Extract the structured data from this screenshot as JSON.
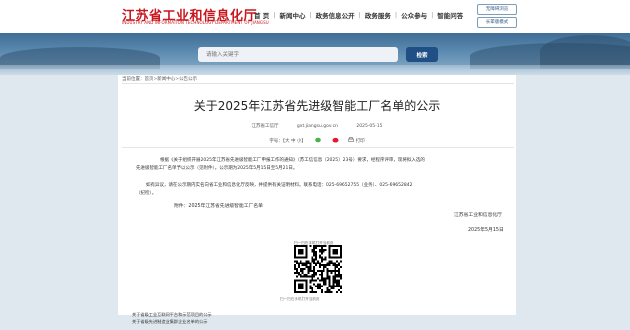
{
  "header": {
    "site_title": "江苏省工业和信息化厅",
    "site_subtitle": "INDUSTRY AND INFORMATION TECHNOLOGY DEPARTMENT OF JIANGSU",
    "nav": [
      "首 页",
      "新闻中心",
      "政务信息公开",
      "政务服务",
      "公众参与",
      "智能问答"
    ],
    "side_buttons": [
      "无障碍浏览",
      "长辈版模式"
    ]
  },
  "search": {
    "placeholder": "请输入关键字",
    "button_label": "检索"
  },
  "breadcrumb": {
    "label": "当前位置：",
    "items": [
      "首页",
      "新闻中心",
      "公告公示"
    ]
  },
  "article": {
    "title": "关于2025年江苏省先进级智能工厂名单的公示",
    "source": "江苏省工信厅",
    "url": "gxt.jiangsu.gov.cn",
    "date": "2025-05-15",
    "font_size_label": "字号：【大 中 小】",
    "print_label": "打印",
    "paragraph1": [
      "根据《关于组织开展2025年江苏省先进级智能工厂申报工作的通知》（苏工信信息〔2025〕23号）要求，经程序评审，现将拟入选的",
      "先进级智能工厂名单予以公示（见附件）。公示期为2025年5月15日至5月21日。"
    ],
    "paragraph2": [
      "如有异议，请在公示期内实名向省工业和信息化厅反映，并提供有关证明材料。联系电话：025-69652755（业务）、025-69652842",
      "（纪检）。"
    ],
    "attachment": "附件：2025年江苏省先进级智能工厂名单",
    "signature_org": "江苏省工业和信息化厅",
    "signature_date": "2025年5月15日",
    "qr_title": "扫一扫在手机打开当前页",
    "qr_caption": "扫一扫在手机打开当前页"
  },
  "footer": {
    "lines": [
      "关于省级工业互联网平台和示范项目的公示",
      "关于省级先进制造业集群企业名单的公示"
    ]
  },
  "colors": {
    "brand_red": "#c8161e",
    "search_button": "#1f4f84",
    "page_background": "#dfe8ee"
  }
}
